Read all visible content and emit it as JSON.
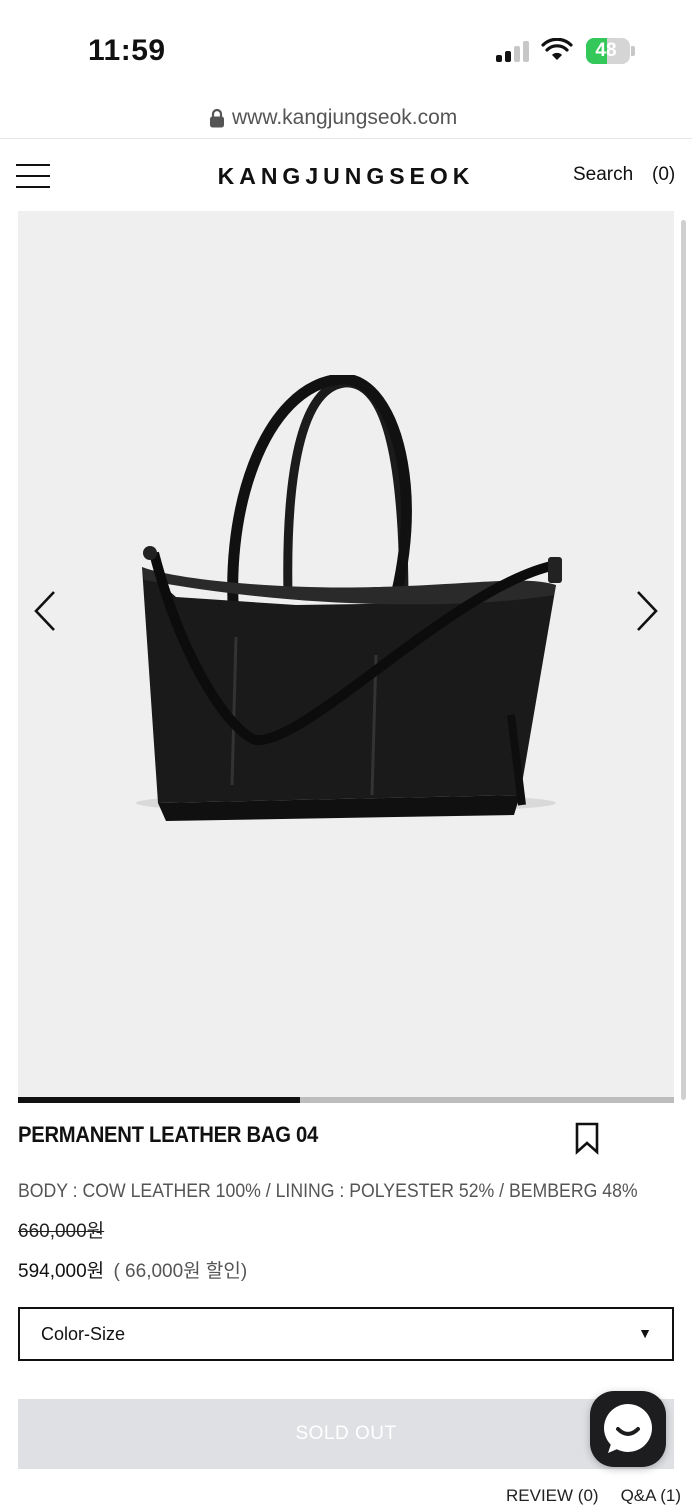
{
  "status": {
    "time": "11:59",
    "battery": "48",
    "battery_level": 0.48
  },
  "browser": {
    "url": "www.kangjungseok.com"
  },
  "header": {
    "logo": "KANGJUNGSEOK",
    "search_label": "Search",
    "cart_count": "(0)"
  },
  "gallery": {
    "progress": 0.43
  },
  "product": {
    "title": "PERMANENT LEATHER BAG 04",
    "material": "BODY : COW LEATHER 100% / LINING : POLYESTER 52% / BEMBERG 48%",
    "original_price": "660,000원",
    "sale_price": "594,000원",
    "discount": "( 66,000원 할인)"
  },
  "option_select": {
    "label": "Color-Size",
    "caret": "▼"
  },
  "buy": {
    "soldout_label": "SOLD OUT"
  },
  "tabs": [
    {
      "label": "REVIEW (0)"
    },
    {
      "label": "Q&A (1)"
    }
  ],
  "icons": [
    "lock-icon",
    "menu-icon",
    "arrow-left-icon",
    "arrow-right-icon",
    "bookmark-icon",
    "chat-icon",
    "wifi-icon",
    "signal-icon",
    "battery-icon"
  ]
}
